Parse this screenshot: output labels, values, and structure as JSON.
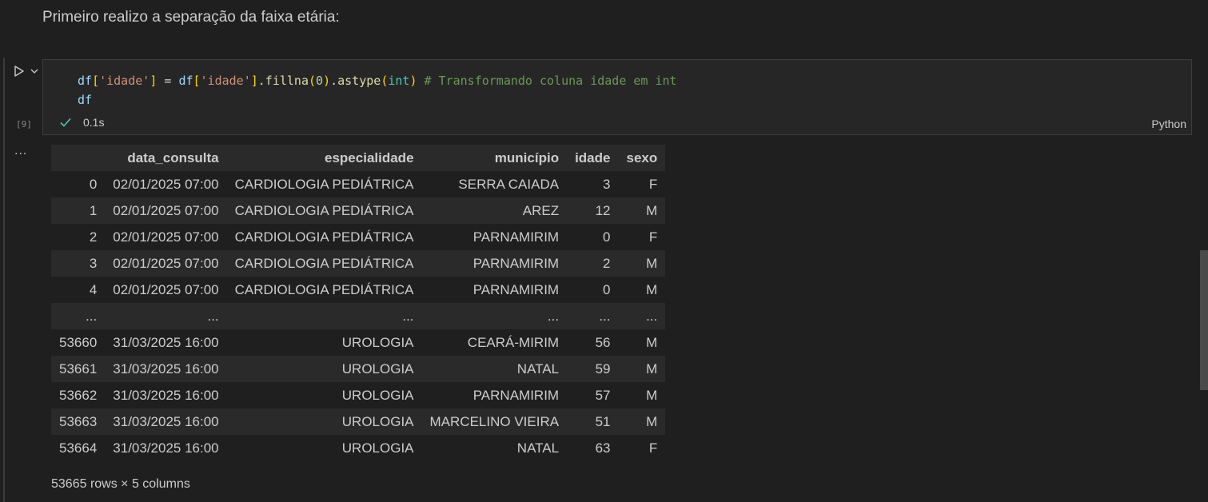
{
  "markdown": {
    "text": "Primeiro realizo a separação da faixa etária:"
  },
  "cell": {
    "execution_count": "[9]",
    "exec_time": "0.1s",
    "language": "Python",
    "code": {
      "l1_df1": "df",
      "l1_b1": "[",
      "l1_s1": "'idade'",
      "l1_b1c": "]",
      "l1_eq": " = ",
      "l1_df2": "df",
      "l1_b2": "[",
      "l1_s2": "'idade'",
      "l1_b2c": "]",
      "l1_m1": ".fillna",
      "l1_p1": "(",
      "l1_n0": "0",
      "l1_p1c": ")",
      "l1_dot": ".",
      "l1_m2": "astype",
      "l1_p2": "(",
      "l1_int": "int",
      "l1_p2c": ")",
      "l1_cmt": " # Transformando coluna idade em int",
      "l2": "df"
    }
  },
  "output": {
    "ellipsis": "...",
    "columns": [
      "",
      "data_consulta",
      "especialidade",
      "município",
      "idade",
      "sexo"
    ],
    "rows": [
      [
        "0",
        "02/01/2025 07:00",
        "CARDIOLOGIA PEDIÁTRICA",
        "SERRA CAIADA",
        "3",
        "F"
      ],
      [
        "1",
        "02/01/2025 07:00",
        "CARDIOLOGIA PEDIÁTRICA",
        "AREZ",
        "12",
        "M"
      ],
      [
        "2",
        "02/01/2025 07:00",
        "CARDIOLOGIA PEDIÁTRICA",
        "PARNAMIRIM",
        "0",
        "F"
      ],
      [
        "3",
        "02/01/2025 07:00",
        "CARDIOLOGIA PEDIÁTRICA",
        "PARNAMIRIM",
        "2",
        "M"
      ],
      [
        "4",
        "02/01/2025 07:00",
        "CARDIOLOGIA PEDIÁTRICA",
        "PARNAMIRIM",
        "0",
        "M"
      ],
      [
        "...",
        "...",
        "...",
        "...",
        "...",
        "..."
      ],
      [
        "53660",
        "31/03/2025 16:00",
        "UROLOGIA",
        "CEARÁ-MIRIM",
        "56",
        "M"
      ],
      [
        "53661",
        "31/03/2025 16:00",
        "UROLOGIA",
        "NATAL",
        "59",
        "M"
      ],
      [
        "53662",
        "31/03/2025 16:00",
        "UROLOGIA",
        "PARNAMIRIM",
        "57",
        "M"
      ],
      [
        "53663",
        "31/03/2025 16:00",
        "UROLOGIA",
        "MARCELINO VIEIRA",
        "51",
        "M"
      ],
      [
        "53664",
        "31/03/2025 16:00",
        "UROLOGIA",
        "NATAL",
        "63",
        "F"
      ]
    ],
    "shape": "53665 rows × 5 columns"
  },
  "icons": {
    "run": "run-icon",
    "chevron": "chevron-down-icon",
    "check": "check-icon"
  },
  "colors": {
    "background": "#1f1f1f",
    "cell_background": "#262626",
    "check": "#4ec9b0",
    "comment": "#6a9955"
  }
}
